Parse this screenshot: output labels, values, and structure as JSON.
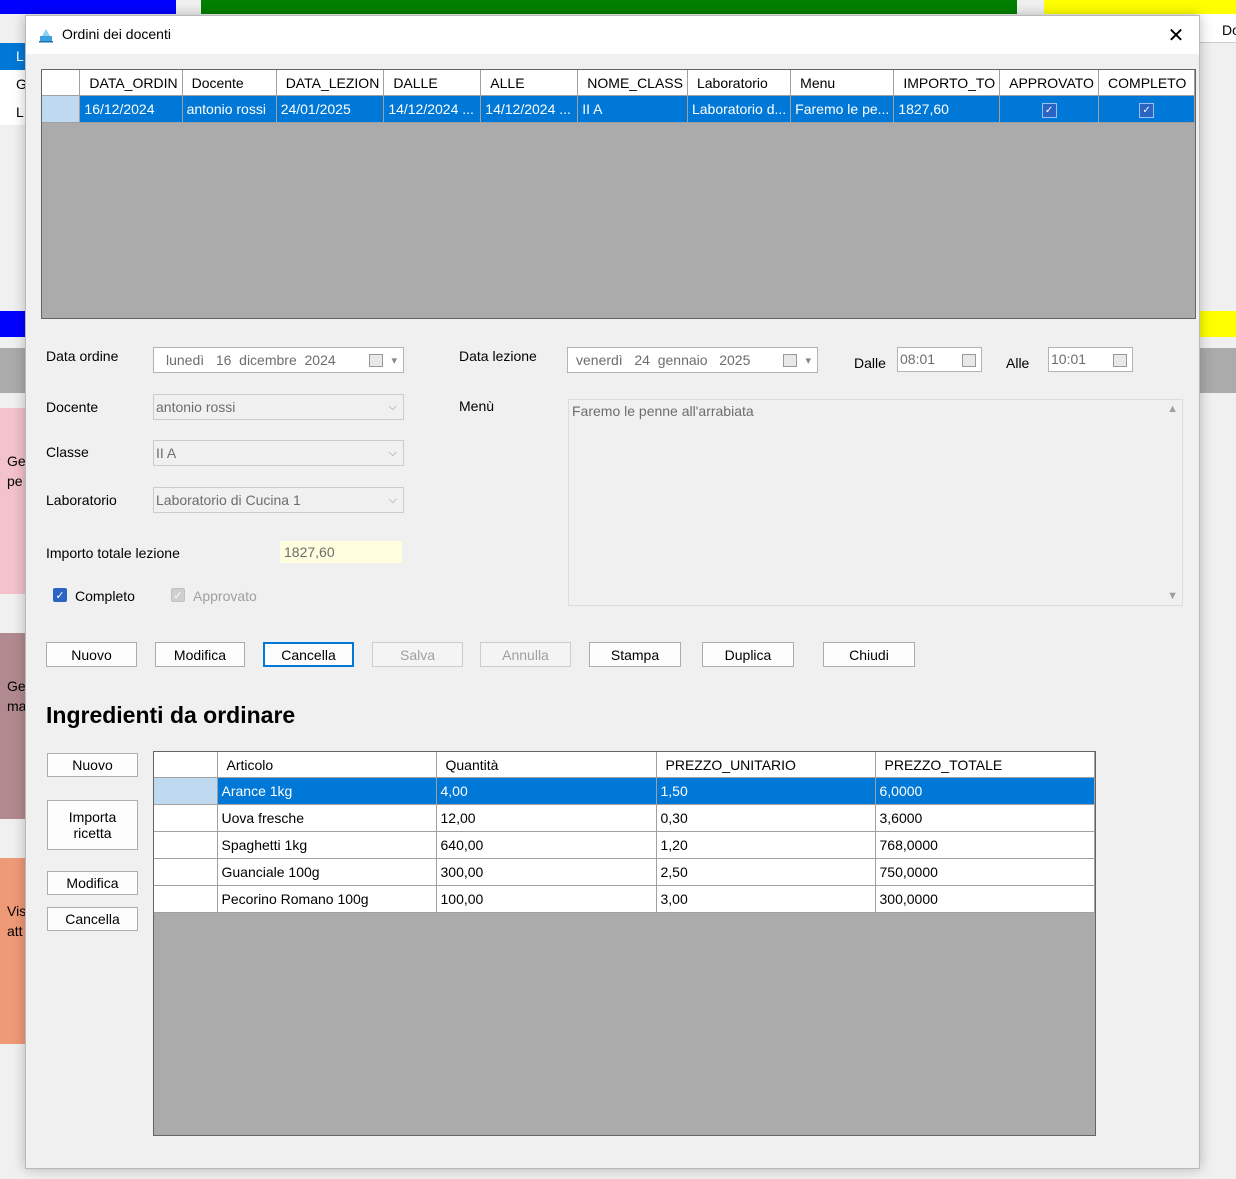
{
  "background": {
    "colors": {
      "blue": "#0000ff",
      "green": "#008000",
      "yellow": "#ffff00",
      "pink": "#f4c2cc",
      "mauve": "#b18a8f",
      "salmon": "#ef9a77"
    },
    "texts": [
      "L",
      "G",
      "L",
      "Ge",
      "pe",
      "Ge",
      "ma",
      "Vis",
      "att",
      "Do"
    ]
  },
  "window": {
    "title": "Ordini dei docenti",
    "close_glyph": "✕",
    "app_icon": "app-icon"
  },
  "orders_grid": {
    "columns": [
      "DATA_ORDIN",
      "Docente",
      "DATA_LEZION",
      "DALLE",
      "ALLE",
      "NOME_CLASS",
      "Laboratorio",
      "Menu",
      "IMPORTO_TO",
      "APPROVATO",
      "COMPLETO"
    ],
    "rows": [
      {
        "data_ordine": "16/12/2024",
        "docente": "antonio rossi",
        "data_lezione": "24/01/2025",
        "dalle": "14/12/2024 ...",
        "alle": "14/12/2024 ...",
        "nome_classe": "II A",
        "laboratorio": "Laboratorio d...",
        "menu": "Faremo le pe...",
        "importo": "1827,60",
        "approvato": true,
        "completo": true
      }
    ]
  },
  "form": {
    "data_ordine_label": "Data ordine",
    "data_ordine_value": "lunedì   16  dicembre  2024",
    "data_lezione_label": "Data lezione",
    "data_lezione_value": "venerdì   24  gennaio   2025",
    "dalle_label": "Dalle",
    "dalle_value": "08:01",
    "alle_label": "Alle",
    "alle_value": "10:01",
    "docente_label": "Docente",
    "docente_value": "antonio rossi",
    "menu_label": "Menù",
    "menu_value": "Faremo le penne all'arrabiata",
    "classe_label": "Classe",
    "classe_value": "II A",
    "laboratorio_label": "Laboratorio",
    "laboratorio_value": "Laboratorio di Cucina 1",
    "importo_label": "Importo totale lezione",
    "importo_value": "1827,60",
    "completo_label": "Completo",
    "completo_checked": true,
    "approvato_label": "Approvato",
    "approvato_checked": true
  },
  "toolbar": {
    "nuovo": "Nuovo",
    "modifica": "Modifica",
    "cancella": "Cancella",
    "salva": "Salva",
    "annulla": "Annulla",
    "stampa": "Stampa",
    "duplica": "Duplica",
    "chiudi": "Chiudi"
  },
  "ingredients": {
    "heading": "Ingredienti da ordinare",
    "buttons": {
      "nuovo": "Nuovo",
      "importa_ricetta": "Importa ricetta",
      "modifica": "Modifica",
      "cancella": "Cancella"
    },
    "columns": [
      "Articolo",
      "Quantità",
      "PREZZO_UNITARIO",
      "PREZZO_TOTALE"
    ],
    "rows": [
      {
        "articolo": "Arance 1kg",
        "quantita": "4,00",
        "prezzo_unitario": "1,50",
        "prezzo_totale": "6,0000"
      },
      {
        "articolo": "Uova fresche",
        "quantita": "12,00",
        "prezzo_unitario": "0,30",
        "prezzo_totale": "3,6000"
      },
      {
        "articolo": "Spaghetti 1kg",
        "quantita": "640,00",
        "prezzo_unitario": "1,20",
        "prezzo_totale": "768,0000"
      },
      {
        "articolo": "Guanciale 100g",
        "quantita": "300,00",
        "prezzo_unitario": "2,50",
        "prezzo_totale": "750,0000"
      },
      {
        "articolo": "Pecorino Romano 100g",
        "quantita": "100,00",
        "prezzo_unitario": "3,00",
        "prezzo_totale": "300,0000"
      }
    ]
  }
}
